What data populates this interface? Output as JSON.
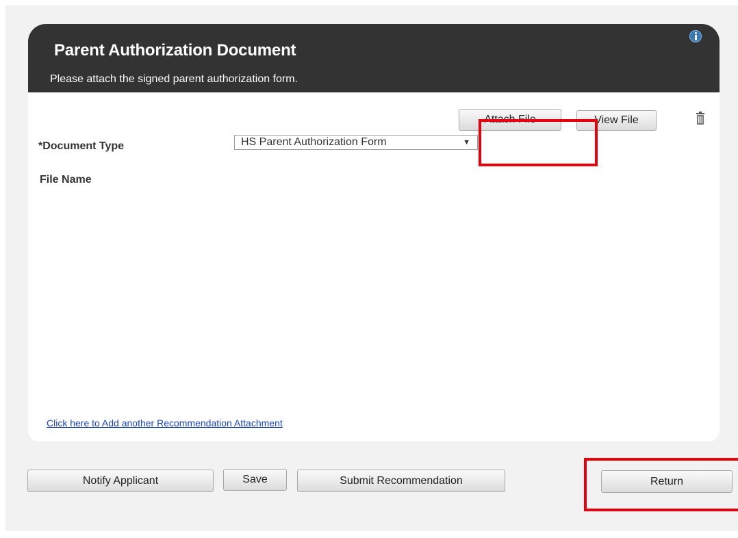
{
  "panel": {
    "title": "Parent Authorization Document",
    "subtitle": "Please attach the signed parent authorization form."
  },
  "form": {
    "document_type_label": "*Document Type",
    "document_type_value": "HS Parent Authorization Form",
    "file_name_label": "File Name",
    "attach_file_label": "Attach File",
    "view_file_label": "View File",
    "add_attachment_link": "Click here to Add another Recommendation Attachment"
  },
  "actions": {
    "notify_label": "Notify Applicant",
    "save_label": "Save",
    "submit_label": "Submit Recommendation",
    "return_label": "Return"
  },
  "icons": {
    "info": "info-icon",
    "trash": "trash-icon"
  },
  "colors": {
    "header_bg": "#333333",
    "highlight": "#e8000c",
    "link": "#1a44b8",
    "info": "#3a78b4"
  }
}
